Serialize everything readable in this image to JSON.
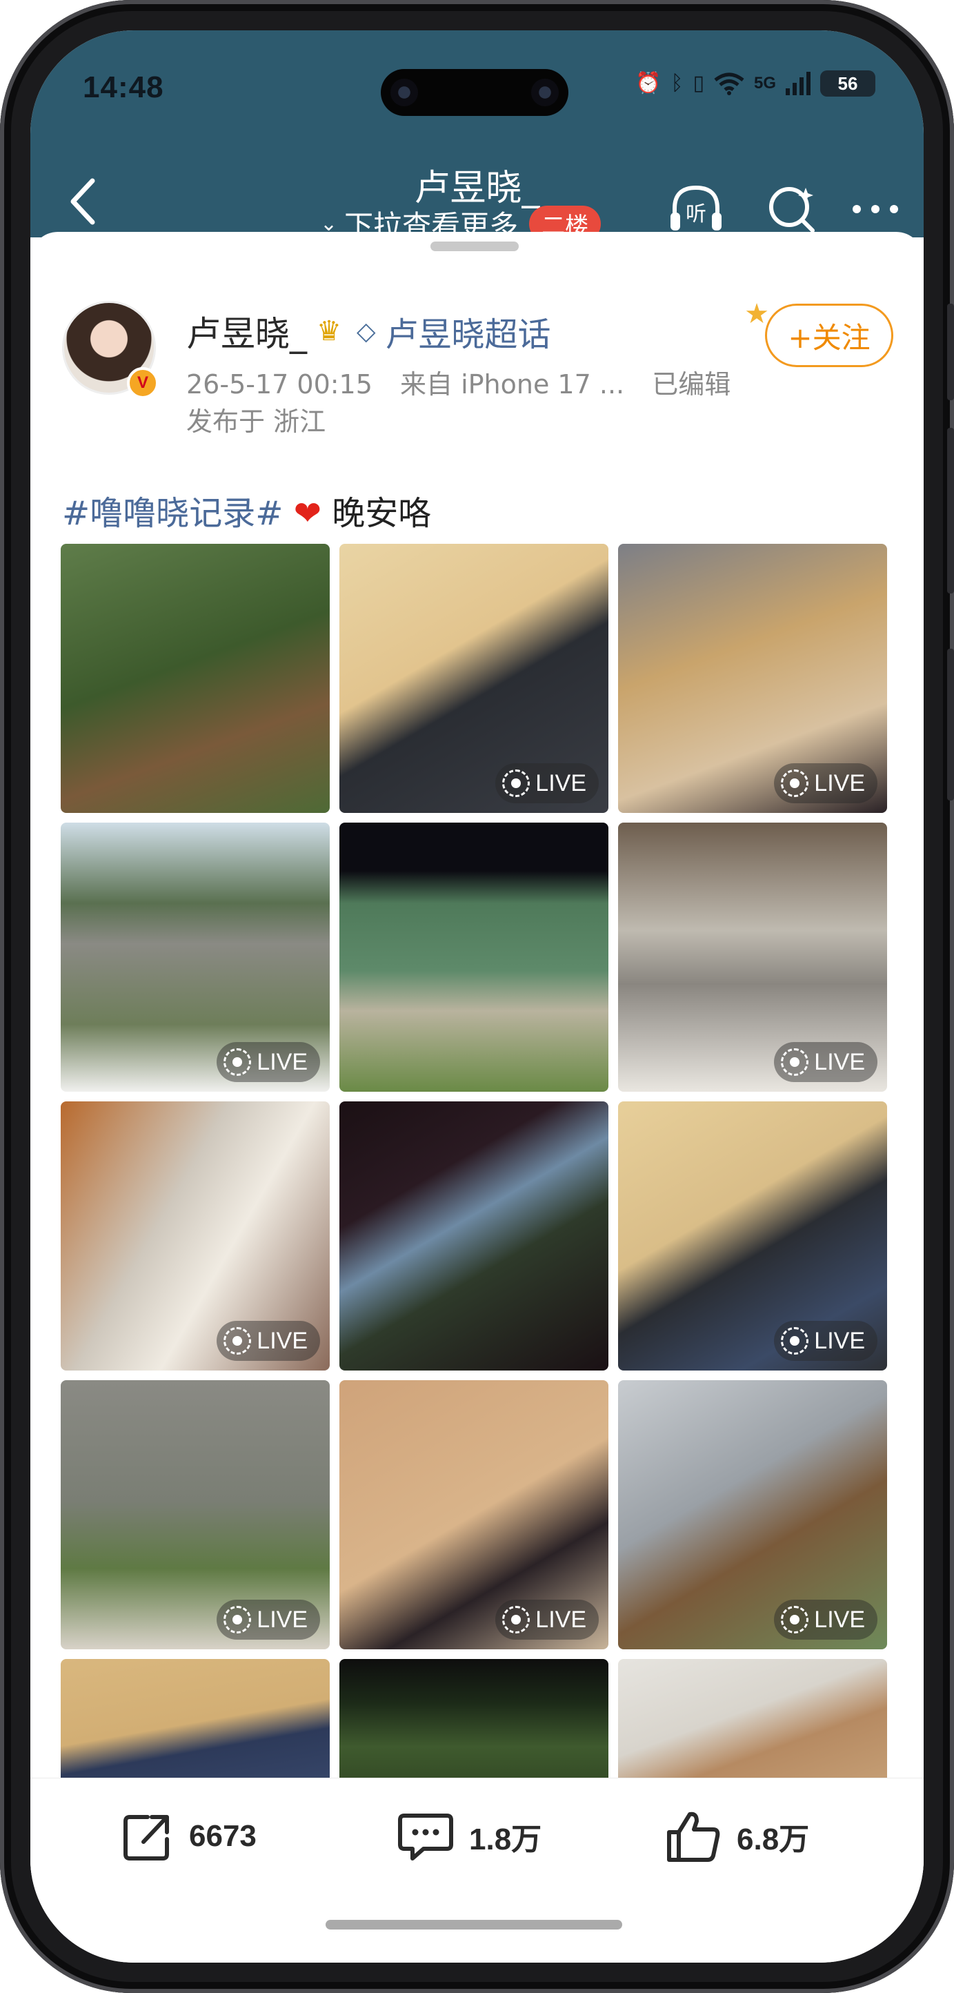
{
  "status_bar": {
    "time": "14:48",
    "network": "5G",
    "battery": "56"
  },
  "nav": {
    "title": "卢昱晓_",
    "subtitle": "下拉查看更多",
    "floor_badge": "二楼",
    "listen_label": "听"
  },
  "post": {
    "username": "卢昱晓_",
    "supertopic": "卢昱晓超话",
    "datetime": "26-5-17 00:15",
    "source": "来自 iPhone 17 ...",
    "edited": "已编辑",
    "location": "发布于 浙江",
    "follow_label": "+关注",
    "hashtag": "#噜噜晓记录#",
    "text": "晚安咯",
    "verified_badge": "V"
  },
  "photos": [
    {
      "live": false,
      "desc": "garden"
    },
    {
      "live": true,
      "desc": "stairs"
    },
    {
      "live": true,
      "desc": "dog-selfie"
    },
    {
      "live": true,
      "desc": "cliff-dog"
    },
    {
      "live": false,
      "desc": "movie-collage"
    },
    {
      "live": true,
      "desc": "mirror-shelf"
    },
    {
      "live": true,
      "desc": "dog-goggles"
    },
    {
      "live": false,
      "desc": "window-sky"
    },
    {
      "live": true,
      "desc": "stairs-dogs"
    },
    {
      "live": true,
      "desc": "cliff-lawn"
    },
    {
      "live": true,
      "desc": "floor-dogs"
    },
    {
      "live": true,
      "desc": "coffee-pose"
    },
    {
      "live": false,
      "desc": "stairs-dog"
    },
    {
      "live": false,
      "desc": "trees"
    },
    {
      "live": false,
      "desc": "dogs-sofa"
    }
  ],
  "live_label": "LIVE",
  "actions": {
    "share_count": "6673",
    "comment_count": "1.8万",
    "like_count": "6.8万"
  }
}
